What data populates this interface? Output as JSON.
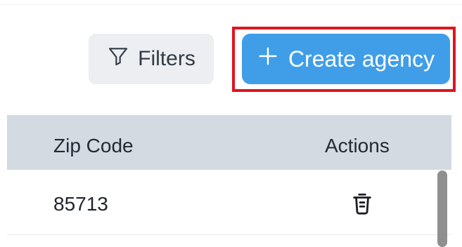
{
  "toolbar": {
    "filters_label": "Filters",
    "create_label": "Create agency"
  },
  "colors": {
    "primary": "#409ee8",
    "highlight": "#e0141f",
    "header_bg": "#d3dae2"
  },
  "table": {
    "columns": [
      "Zip Code",
      "Actions"
    ],
    "rows": [
      {
        "zip_code": "85713"
      }
    ]
  }
}
